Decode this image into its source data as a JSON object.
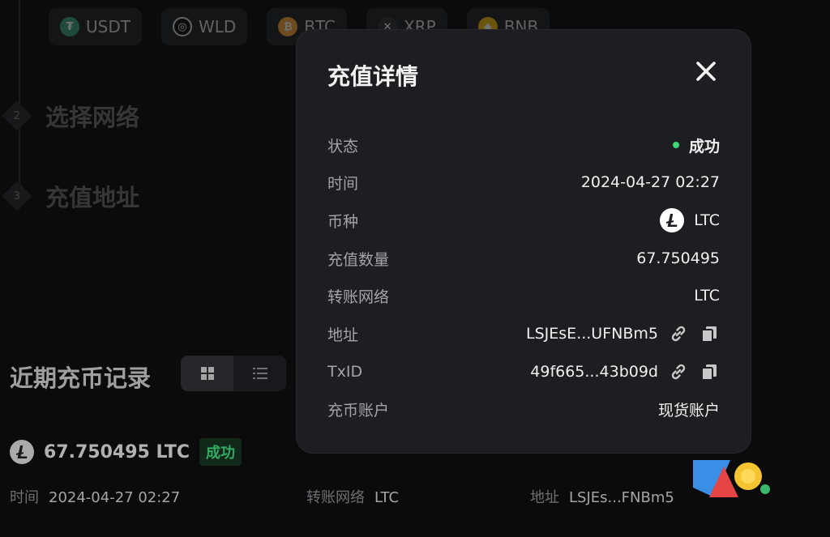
{
  "coins": [
    {
      "label": "USDT",
      "icon": "usdt-coin-icon",
      "color": "#3aa384"
    },
    {
      "label": "WLD",
      "icon": "wld-coin-icon",
      "color": "#111111"
    },
    {
      "label": "BTC",
      "icon": "btc-coin-icon",
      "color": "#f2a33a"
    },
    {
      "label": "XRP",
      "icon": "xrp-coin-icon",
      "color": "#333333"
    },
    {
      "label": "BNB",
      "icon": "bnb-coin-icon",
      "color": "#f0b90b"
    }
  ],
  "steps": [
    {
      "num": "2",
      "label": "选择网络"
    },
    {
      "num": "3",
      "label": "充值地址"
    }
  ],
  "recent": {
    "title": "近期充币记录",
    "amount": "67.750495 LTC",
    "status": "成功",
    "time_label": "时间",
    "time_value": "2024-04-27 02:27",
    "network_label": "转账网络",
    "network_value": "LTC",
    "address_label": "地址",
    "address_value": "LSJEs...FNBm5"
  },
  "modal": {
    "title": "充值详情",
    "status_label": "状态",
    "status_value": "成功",
    "time_label": "时间",
    "time_value": "2024-04-27 02:27",
    "coin_label": "币种",
    "coin_value": "LTC",
    "amount_label": "充值数量",
    "amount_value": "67.750495",
    "network_label": "转账网络",
    "network_value": "LTC",
    "address_label": "地址",
    "address_value": "LSJEsE...UFNBm5",
    "txid_label": "TxID",
    "txid_value": "49f665...43b09d",
    "account_label": "充币账户",
    "account_value": "现货账户"
  },
  "colors": {
    "success": "#3dd77a",
    "modal_bg": "#1c1e21",
    "page_bg": "#0b0b0c"
  }
}
